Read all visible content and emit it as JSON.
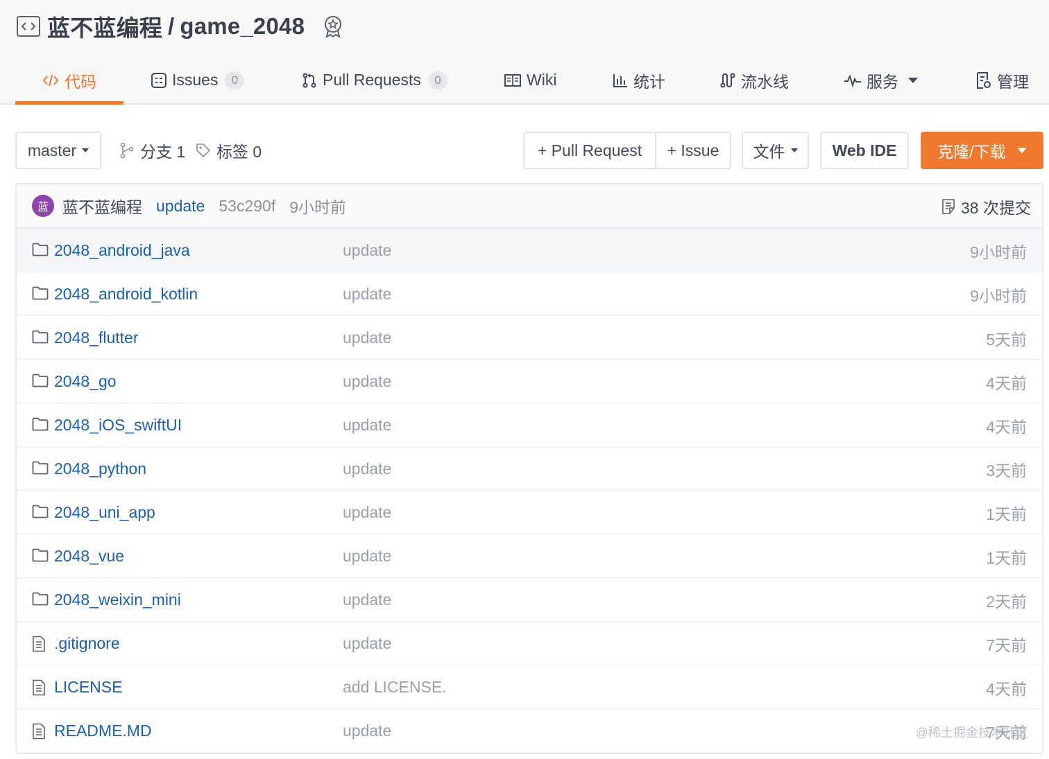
{
  "repo": {
    "owner": "蓝不蓝编程",
    "separator": "/",
    "name": "game_2048",
    "icons": {
      "repo": "code-repo-icon",
      "badge": "award-badge-icon"
    }
  },
  "tabs": [
    {
      "label": "代码",
      "icon": "code-icon",
      "active": true
    },
    {
      "label": "Issues",
      "icon": "issues-icon",
      "count": "0"
    },
    {
      "label": "Pull Requests",
      "icon": "pull-request-icon",
      "count": "0"
    },
    {
      "label": "Wiki",
      "icon": "wiki-icon"
    },
    {
      "label": "统计",
      "icon": "stats-icon"
    },
    {
      "label": "流水线",
      "icon": "pipeline-icon"
    },
    {
      "label": "服务",
      "icon": "service-icon",
      "dropdown": true
    },
    {
      "label": "管理",
      "icon": "manage-icon"
    }
  ],
  "toolbar": {
    "branch_select": "master",
    "branches_label": "分支 1",
    "tags_label": "标签 0",
    "new_pr": "+ Pull Request",
    "new_issue": "+ Issue",
    "file_menu": "文件",
    "web_ide": "Web IDE",
    "clone": "克隆/下载"
  },
  "latest_commit": {
    "avatar_text": "蓝",
    "author": "蓝不蓝编程",
    "message": "update",
    "sha": "53c290f",
    "time": "9小时前",
    "commit_count": "38 次提交"
  },
  "files": [
    {
      "name": "2048_android_java",
      "type": "folder",
      "message": "update",
      "time": "9小时前"
    },
    {
      "name": "2048_android_kotlin",
      "type": "folder",
      "message": "update",
      "time": "9小时前"
    },
    {
      "name": "2048_flutter",
      "type": "folder",
      "message": "update",
      "time": "5天前"
    },
    {
      "name": "2048_go",
      "type": "folder",
      "message": "update",
      "time": "4天前"
    },
    {
      "name": "2048_iOS_swiftUI",
      "type": "folder",
      "message": "update",
      "time": "4天前"
    },
    {
      "name": "2048_python",
      "type": "folder",
      "message": "update",
      "time": "3天前"
    },
    {
      "name": "2048_uni_app",
      "type": "folder",
      "message": "update",
      "time": "1天前"
    },
    {
      "name": "2048_vue",
      "type": "folder",
      "message": "update",
      "time": "1天前"
    },
    {
      "name": "2048_weixin_mini",
      "type": "folder",
      "message": "update",
      "time": "2天前"
    },
    {
      "name": ".gitignore",
      "type": "file",
      "message": "update",
      "time": "7天前"
    },
    {
      "name": "LICENSE",
      "type": "file",
      "message": "add LICENSE.",
      "time": "4天前"
    },
    {
      "name": "README.MD",
      "type": "file",
      "message": "update",
      "time": "7天前"
    }
  ],
  "watermark": "@稀土掘金技术社区",
  "colors": {
    "accent": "#f0792e",
    "link": "#1a5fb4",
    "muted": "#9aa0ab",
    "avatar": "#8e44ad"
  }
}
